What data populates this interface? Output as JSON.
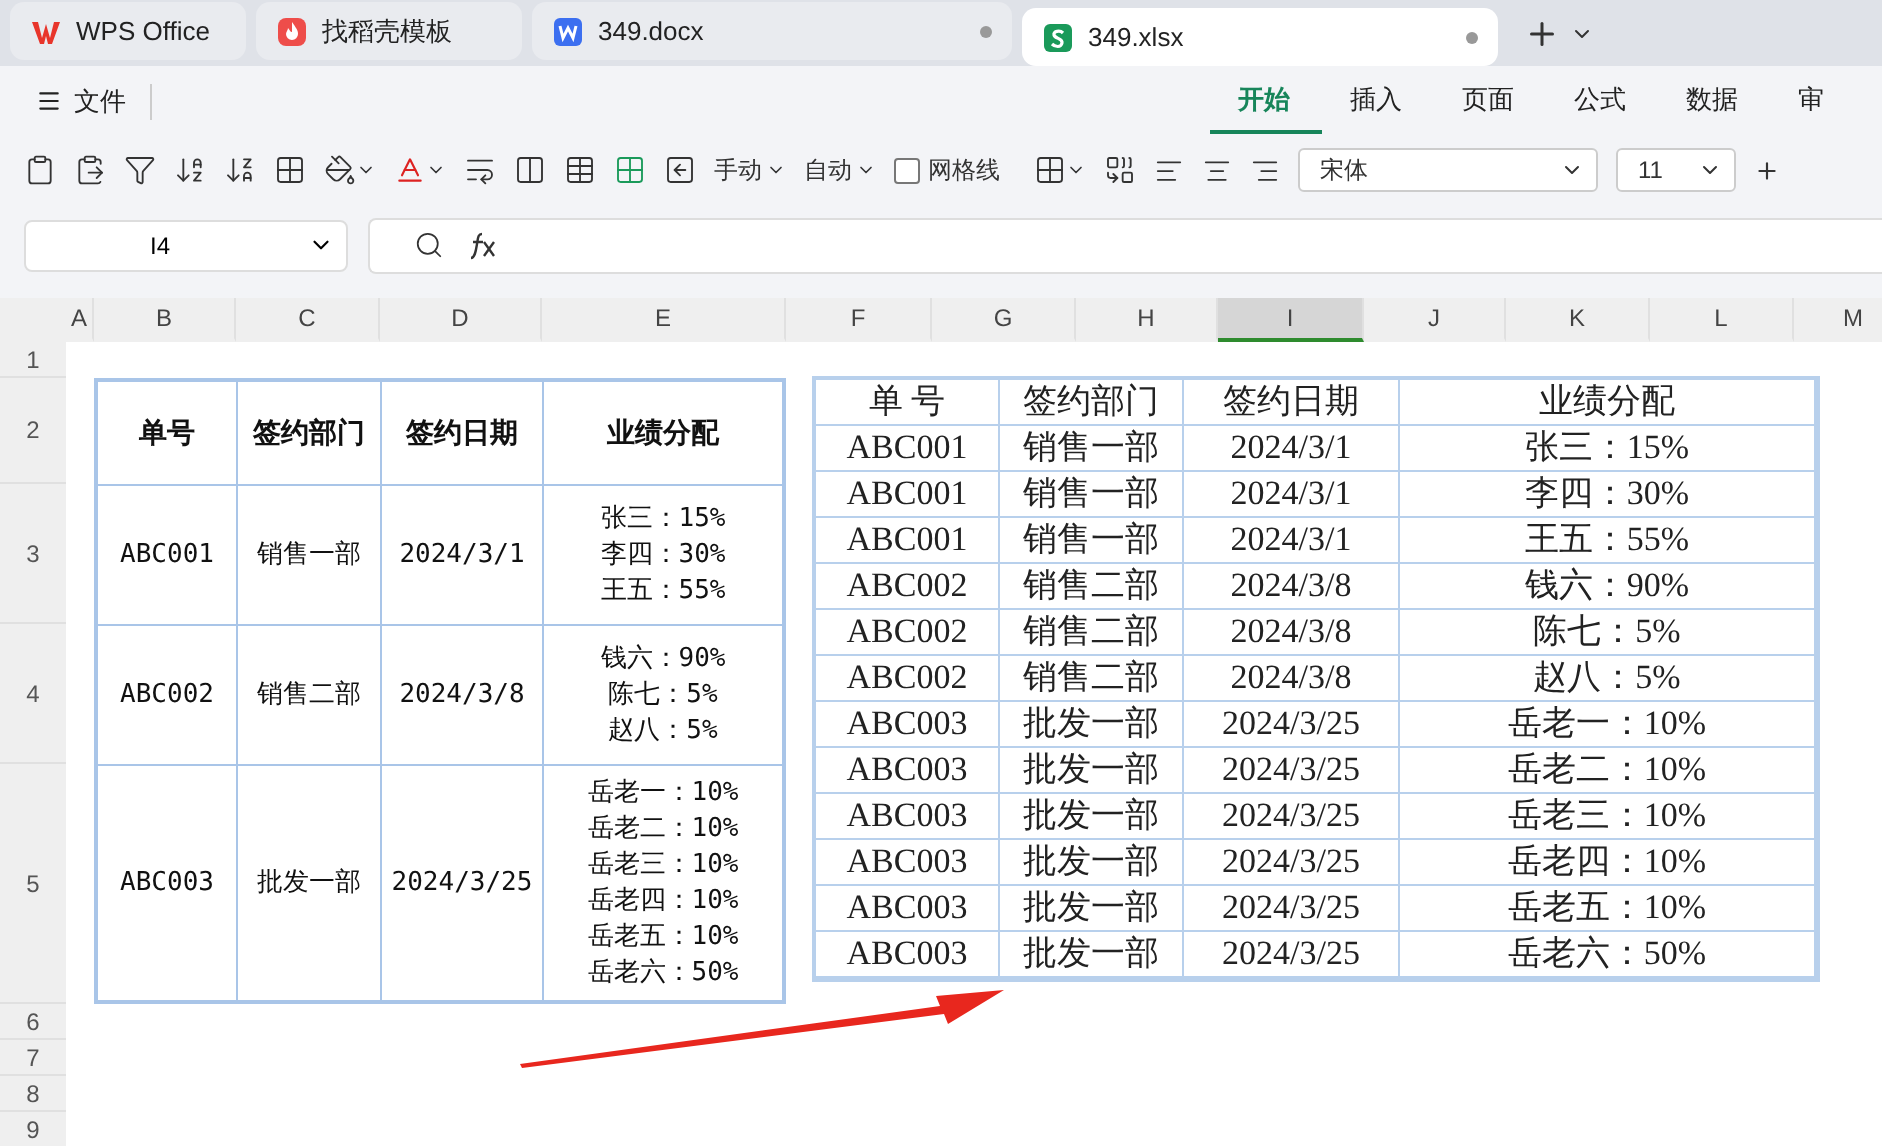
{
  "tabs": [
    {
      "kind": "wps",
      "label": "WPS Office",
      "selected": false,
      "modified": false
    },
    {
      "kind": "template",
      "label": "找稻壳模板",
      "selected": false,
      "modified": false
    },
    {
      "kind": "word",
      "label": "349.docx",
      "selected": false,
      "modified": true
    },
    {
      "kind": "sheet",
      "label": "349.xlsx",
      "selected": true,
      "modified": true
    }
  ],
  "menu": {
    "file": "文件",
    "ribbon_tabs": [
      {
        "label": "开始",
        "selected": true
      },
      {
        "label": "插入",
        "selected": false
      },
      {
        "label": "页面",
        "selected": false
      },
      {
        "label": "公式",
        "selected": false
      },
      {
        "label": "数据",
        "selected": false
      },
      {
        "label": "审",
        "selected": false
      }
    ]
  },
  "toolbar": {
    "row_height": "手动",
    "col_width": "自动",
    "gridlines": {
      "label": "网格线",
      "checked": false
    },
    "font": "宋体",
    "font_size": "11"
  },
  "formula_bar": {
    "cell_ref": "I4"
  },
  "columns": [
    {
      "label": "A",
      "selected": false
    },
    {
      "label": "B",
      "selected": false
    },
    {
      "label": "C",
      "selected": false
    },
    {
      "label": "D",
      "selected": false
    },
    {
      "label": "E",
      "selected": false
    },
    {
      "label": "F",
      "selected": false
    },
    {
      "label": "G",
      "selected": false
    },
    {
      "label": "H",
      "selected": false
    },
    {
      "label": "I",
      "selected": true
    },
    {
      "label": "J",
      "selected": false
    },
    {
      "label": "K",
      "selected": false
    },
    {
      "label": "L",
      "selected": false
    },
    {
      "label": "M",
      "selected": false
    }
  ],
  "row_numbers": [
    "1",
    "2",
    "3",
    "4",
    "5",
    "6",
    "7",
    "8",
    "9"
  ],
  "left_table": {
    "headers": [
      "单号",
      "签约部门",
      "签约日期",
      "业绩分配"
    ],
    "rows": [
      {
        "order": "ABC001",
        "dept": "销售一部",
        "date": "2024/3/1",
        "allocation": [
          "张三：15%",
          "李四：30%",
          "王五：55%"
        ]
      },
      {
        "order": "ABC002",
        "dept": "销售二部",
        "date": "2024/3/8",
        "allocation": [
          "钱六：90%",
          "陈七：5%",
          "赵八：5%"
        ]
      },
      {
        "order": "ABC003",
        "dept": "批发一部",
        "date": "2024/3/25",
        "allocation": [
          "岳老一：10%",
          "岳老二：10%",
          "岳老三：10%",
          "岳老四：10%",
          "岳老五：10%",
          "岳老六：50%"
        ]
      }
    ]
  },
  "right_table": {
    "headers": [
      "单 号",
      "签约部门",
      "签约日期",
      "业绩分配"
    ],
    "rows": [
      [
        "ABC001",
        "销售一部",
        "2024/3/1",
        "张三：15%"
      ],
      [
        "ABC001",
        "销售一部",
        "2024/3/1",
        "李四：30%"
      ],
      [
        "ABC001",
        "销售一部",
        "2024/3/1",
        "王五：55%"
      ],
      [
        "ABC002",
        "销售二部",
        "2024/3/8",
        "钱六：90%"
      ],
      [
        "ABC002",
        "销售二部",
        "2024/3/8",
        "陈七：5%"
      ],
      [
        "ABC002",
        "销售二部",
        "2024/3/8",
        "赵八：5%"
      ],
      [
        "ABC003",
        "批发一部",
        "2024/3/25",
        "岳老一：10%"
      ],
      [
        "ABC003",
        "批发一部",
        "2024/3/25",
        "岳老二：10%"
      ],
      [
        "ABC003",
        "批发一部",
        "2024/3/25",
        "岳老三：10%"
      ],
      [
        "ABC003",
        "批发一部",
        "2024/3/25",
        "岳老四：10%"
      ],
      [
        "ABC003",
        "批发一部",
        "2024/3/25",
        "岳老五：10%"
      ],
      [
        "ABC003",
        "批发一部",
        "2024/3/25",
        "岳老六：50%"
      ]
    ]
  }
}
